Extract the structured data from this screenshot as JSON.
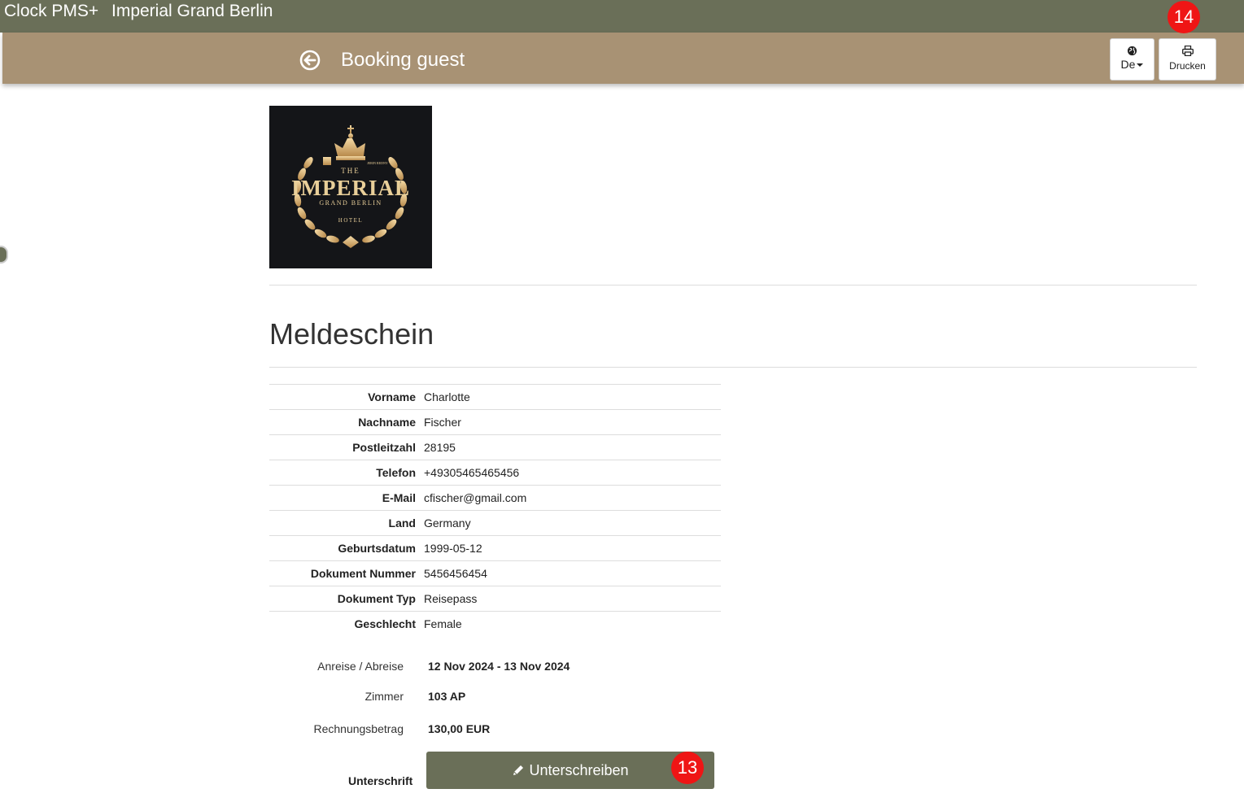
{
  "topbar": {
    "app_name": "Clock PMS+",
    "hotel_name": "Imperial Grand Berlin"
  },
  "subbar": {
    "title": "Booking guest",
    "lang_label": "De",
    "print_label": "Drucken"
  },
  "badges": {
    "print": "14",
    "sign": "13"
  },
  "logo": {
    "line_the": "THE",
    "line_main": "IMPERIAL",
    "line_sub": "GRAND BERLIN",
    "line_hotel": "HOTEL",
    "line_small": "JERIN REDNY"
  },
  "form": {
    "heading": "Meldeschein",
    "fields": [
      {
        "label": "Vorname",
        "value": "Charlotte"
      },
      {
        "label": "Nachname",
        "value": "Fischer"
      },
      {
        "label": "Postleitzahl",
        "value": "28195"
      },
      {
        "label": "Telefon",
        "value": "+49305465465456"
      },
      {
        "label": "E-Mail",
        "value": "cfischer@gmail.com"
      },
      {
        "label": "Land",
        "value": "Germany"
      },
      {
        "label": "Geburtsdatum",
        "value": "1999-05-12"
      },
      {
        "label": "Dokument Nummer",
        "value": "5456456454"
      },
      {
        "label": "Dokument Typ",
        "value": "Reisepass"
      },
      {
        "label": "Geschlecht",
        "value": "Female"
      }
    ]
  },
  "stay": {
    "dates_label": "Anreise / Abreise",
    "dates_value": "12 Nov 2024 - 13 Nov 2024",
    "room_label": "Zimmer",
    "room_value": "103 AP",
    "amount_label": "Rechnungsbetrag",
    "amount_value": "130,00 EUR"
  },
  "signature": {
    "label": "Unterschrift",
    "button_label": "Unterschreiben"
  },
  "colors": {
    "topbar": "#6a6f58",
    "subbar": "#a89274",
    "button": "#6a6f58",
    "badge": "#ef1515"
  }
}
